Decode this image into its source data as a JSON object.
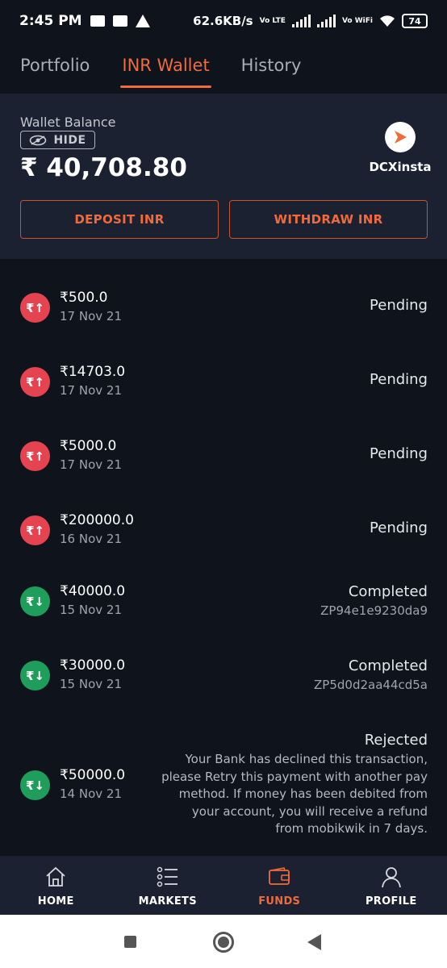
{
  "status_bar": {
    "time": "2:45 PM",
    "speed": "62.6KB/s",
    "battery": "74",
    "volte": "Vo LTE",
    "vowifi": "Vo WiFi"
  },
  "tabs": [
    {
      "label": "Portfolio",
      "active": false
    },
    {
      "label": "INR Wallet",
      "active": true
    },
    {
      "label": "History",
      "active": false
    }
  ],
  "wallet": {
    "label": "Wallet Balance",
    "hide_label": "HIDE",
    "balance": "₹ 40,708.80",
    "insta_label": "DCXinsta",
    "deposit_label": "DEPOSIT INR",
    "withdraw_label": "WITHDRAW INR"
  },
  "transactions": [
    {
      "direction": "out",
      "amount": "₹500.0",
      "date": "17 Nov 21",
      "status": "Pending",
      "ref": "",
      "note": ""
    },
    {
      "direction": "out",
      "amount": "₹14703.0",
      "date": "17 Nov 21",
      "status": "Pending",
      "ref": "",
      "note": ""
    },
    {
      "direction": "out",
      "amount": "₹5000.0",
      "date": "17 Nov 21",
      "status": "Pending",
      "ref": "",
      "note": ""
    },
    {
      "direction": "out",
      "amount": "₹200000.0",
      "date": "16 Nov 21",
      "status": "Pending",
      "ref": "",
      "note": ""
    },
    {
      "direction": "in",
      "amount": "₹40000.0",
      "date": "15 Nov 21",
      "status": "Completed",
      "ref": "ZP94e1e9230da9",
      "note": ""
    },
    {
      "direction": "in",
      "amount": "₹30000.0",
      "date": "15 Nov 21",
      "status": "Completed",
      "ref": "ZP5d0d2aa44cd5a",
      "note": ""
    },
    {
      "direction": "in",
      "amount": "₹50000.0",
      "date": "14 Nov 21",
      "status": "Rejected",
      "ref": "",
      "note": "Your Bank has declined this transaction, please Retry this payment with another pay method. If money has been debited from your account, you will receive a refund from mobikwik in 7 days."
    }
  ],
  "icon_glyphs": {
    "out": "₹↑",
    "in": "₹↓"
  },
  "bottom_nav": [
    {
      "label": "HOME",
      "icon": "home-icon",
      "active": false
    },
    {
      "label": "MARKETS",
      "icon": "list-icon",
      "active": false
    },
    {
      "label": "FUNDS",
      "icon": "wallet-icon",
      "active": true
    },
    {
      "label": "PROFILE",
      "icon": "profile-icon",
      "active": false
    }
  ],
  "colors": {
    "accent": "#f06b3b",
    "pending_red": "#e5434f",
    "success_green": "#1e9e5a",
    "background": "#0f131c",
    "card": "#1b2130"
  }
}
